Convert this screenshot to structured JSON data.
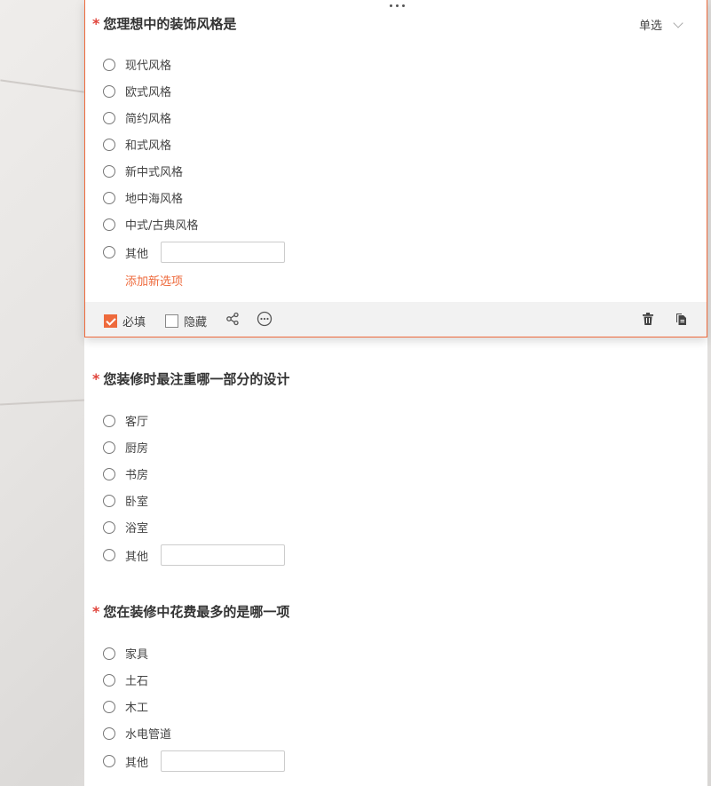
{
  "questions": [
    {
      "title": "您理想中的装饰风格是",
      "required_mark": "*",
      "type": "单选",
      "options": [
        "现代风格",
        "欧式风格",
        "简约风格",
        "和式风格",
        "新中式风格",
        "地中海风格",
        "中式/古典风格",
        "其他"
      ],
      "add_option_label": "添加新选项"
    },
    {
      "title": "您装修时最注重哪一部分的设计",
      "required_mark": "*",
      "options": [
        "客厅",
        "厨房",
        "书房",
        "卧室",
        "浴室",
        "其他"
      ]
    },
    {
      "title": "您在装修中花费最多的是哪一项",
      "required_mark": "*",
      "options": [
        "家具",
        "土石",
        "木工",
        "水电管道",
        "其他"
      ]
    }
  ],
  "toolbar": {
    "required_label": "必填",
    "hidden_label": "隐藏",
    "icons": [
      "logic-icon",
      "more-icon",
      "trash-icon",
      "copy-icon"
    ]
  },
  "colors": {
    "accent": "#ee6a3c",
    "required": "#e0433a"
  }
}
